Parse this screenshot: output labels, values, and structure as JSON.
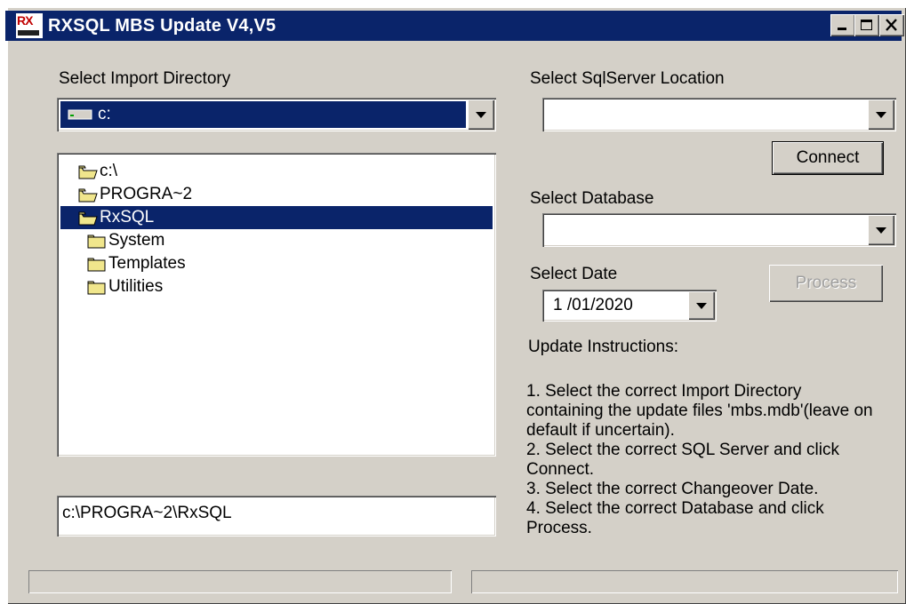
{
  "window": {
    "title": "RXSQL MBS Update V4,V5"
  },
  "left": {
    "import_dir_label": "Select Import Directory",
    "drive_value": "c:",
    "tree": [
      {
        "label": "c:\\",
        "level": 0,
        "open": true,
        "selected": false
      },
      {
        "label": "PROGRA~2",
        "level": 0,
        "open": true,
        "selected": false
      },
      {
        "label": "RxSQL",
        "level": 0,
        "open": true,
        "selected": true
      },
      {
        "label": "System",
        "level": 1,
        "open": false,
        "selected": false
      },
      {
        "label": "Templates",
        "level": 1,
        "open": false,
        "selected": false
      },
      {
        "label": "Utilities",
        "level": 1,
        "open": false,
        "selected": false
      }
    ],
    "path_value": "c:\\PROGRA~2\\RxSQL"
  },
  "right": {
    "server_label": "Select SqlServer Location",
    "server_value": "",
    "connect_label": "Connect",
    "database_label": "Select Database",
    "database_value": "",
    "date_label": "Select Date",
    "date_value": "1 /01/2020",
    "process_label": "Process",
    "instructions_heading": "Update Instructions:",
    "instructions": [
      "1. Select the correct Import Directory containing the update files 'mbs.mdb'(leave on default if uncertain).",
      "2. Select the correct SQL Server and click Connect.",
      "3. Select the correct Changeover Date.",
      "4. Select the correct Database and click Process."
    ]
  },
  "colors": {
    "titlebar": "#0a246a",
    "face": "#d4d0c8",
    "selection": "#0a246a"
  }
}
